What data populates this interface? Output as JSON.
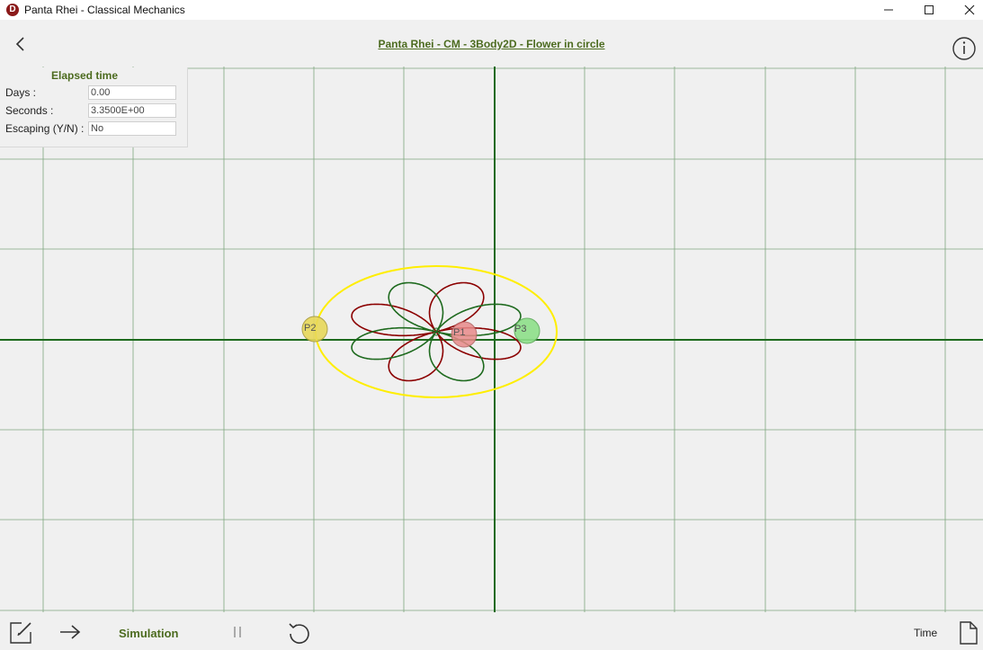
{
  "window": {
    "title": "Panta Rhei - Classical Mechanics",
    "minimize_icon": "minimize-icon",
    "maximize_icon": "maximize-icon",
    "close_icon": "close-icon"
  },
  "header": {
    "title": "Panta Rhei - CM - 3Body2D - Flower in circle",
    "back_icon": "chevron-left-icon",
    "info_icon": "info-icon"
  },
  "elapsed": {
    "title": "Elapsed time",
    "days_label": "Days :",
    "days_value": "0.00",
    "seconds_label": "Seconds :",
    "seconds_value": "3.3500E+00",
    "escaping_label": "Escaping (Y/N) :",
    "escaping_value": "No"
  },
  "simulation": {
    "bodies": [
      {
        "label": "P1",
        "color": "#e88a8a"
      },
      {
        "label": "P2",
        "color": "#e8d85a"
      },
      {
        "label": "P3",
        "color": "#8ee08a"
      }
    ],
    "colors": {
      "grid": "#7fa77f",
      "axis": "#1e6a1e",
      "circle": "#ffee00",
      "orbit_red": "#8b0000",
      "orbit_green": "#1e6a1e"
    }
  },
  "toolbar": {
    "edit_icon": "edit-icon",
    "next_icon": "arrow-right-icon",
    "simulation_label": "Simulation",
    "pause_icon": "pause-icon",
    "reset_icon": "reset-icon",
    "time_label": "Time",
    "document_icon": "document-icon"
  }
}
